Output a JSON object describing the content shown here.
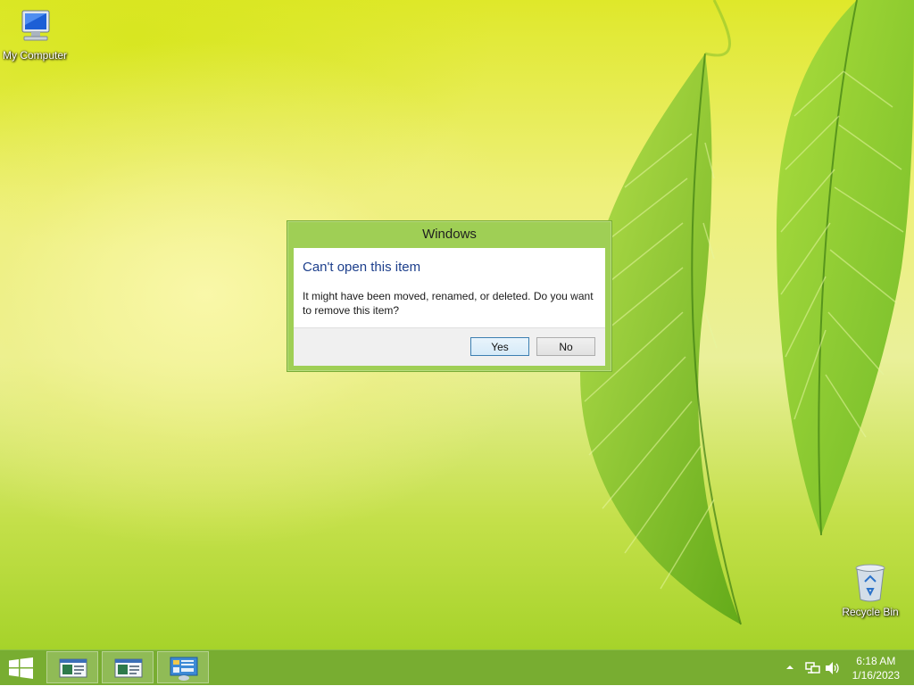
{
  "desktop": {
    "icons": [
      {
        "label": "My Computer",
        "icon": "computer-icon"
      },
      {
        "label": "Recycle Bin",
        "icon": "recycle-bin-icon"
      }
    ]
  },
  "dialog": {
    "title": "Windows",
    "heading": "Can't open this item",
    "message": "It might have been moved, renamed, or deleted. Do you want to remove this item?",
    "yes_label": "Yes",
    "no_label": "No"
  },
  "taskbar": {
    "start_icon": "windows-logo-icon",
    "pinned": [
      "window-app-icon",
      "window-app-icon",
      "control-panel-icon"
    ],
    "tray_icons": [
      "chevron-up-icon",
      "network-icon",
      "volume-icon"
    ],
    "time": "6:18 AM",
    "date": "1/16/2023"
  },
  "colors": {
    "taskbar": "#78ad31",
    "dialog_frame": "#9fcf55",
    "heading_text": "#1d3f8c",
    "default_button_border": "#3c7fb1"
  }
}
